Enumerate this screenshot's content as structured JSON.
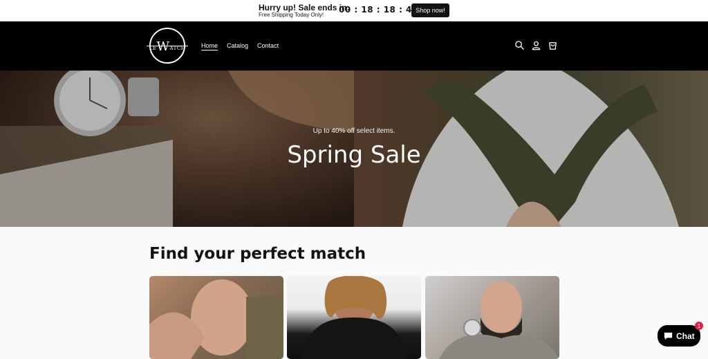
{
  "announcement": {
    "headline": "Hurry up! Sale ends in:",
    "subline": "Free Shipping Today Only!",
    "countdown": "00 : 18 : 18 : 44",
    "button_label": "Shop now!"
  },
  "header": {
    "logo_text": "LE ATCH",
    "logo_letter": "W",
    "nav": [
      {
        "label": "Home",
        "active": true
      },
      {
        "label": "Catalog",
        "active": false
      },
      {
        "label": "Contact",
        "active": false
      }
    ],
    "icons": [
      "search-icon",
      "account-icon",
      "cart-icon"
    ]
  },
  "hero": {
    "subtitle": "Up to 40% off select items.",
    "title": "Spring Sale"
  },
  "collection": {
    "title": "Find your perfect match",
    "cards": [
      "collection-card-1",
      "collection-card-2",
      "collection-card-3"
    ]
  },
  "chat": {
    "label": "Chat",
    "badge": "1"
  },
  "colors": {
    "header_bg": "#000000",
    "page_bg": "#fafafa",
    "button_bg": "#121212",
    "badge": "#e0224a"
  }
}
